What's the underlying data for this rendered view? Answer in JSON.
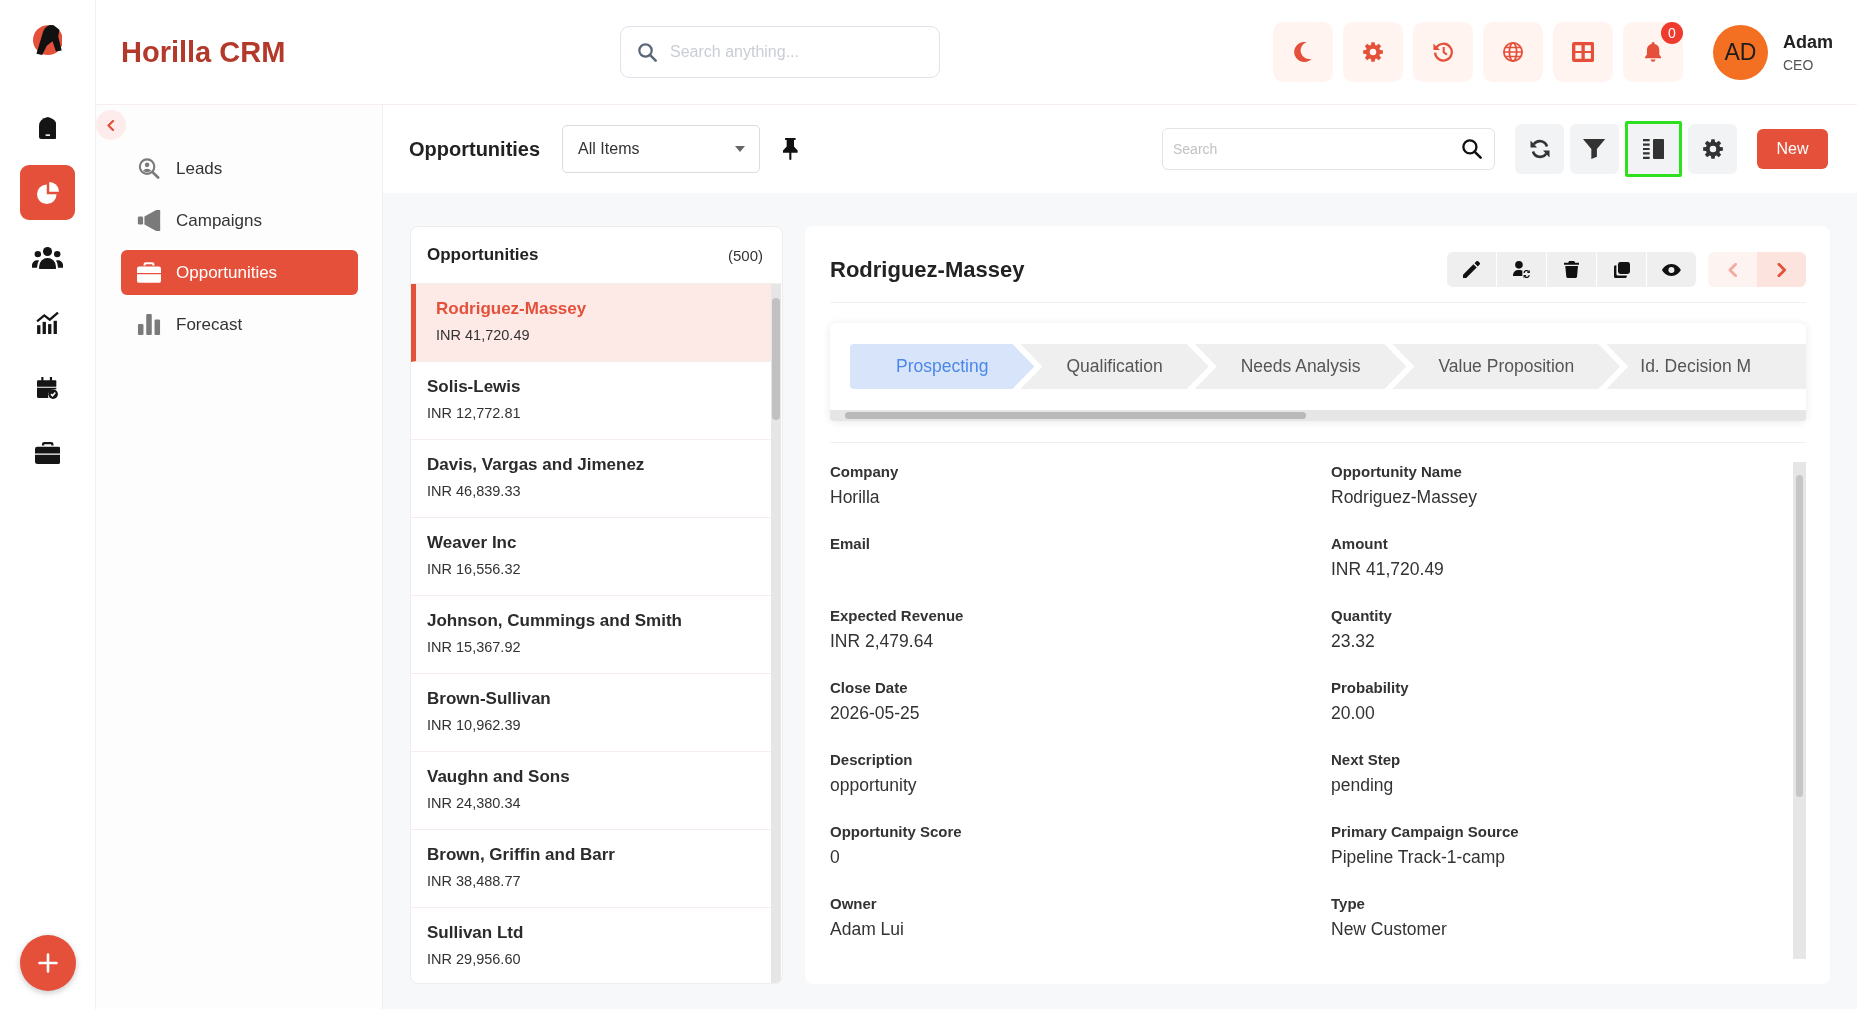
{
  "rail": [
    {
      "selected": false
    },
    {
      "selected": true
    },
    {
      "selected": false
    },
    {
      "selected": false
    },
    {
      "selected": false
    },
    {
      "selected": false
    }
  ],
  "header": {
    "title": "Horilla CRM",
    "search": {
      "placeholder": "Search anything..."
    },
    "notification_count": "0",
    "user": {
      "initials": "AD",
      "name": "Adam",
      "role": "CEO"
    }
  },
  "sidebar": {
    "items": [
      {
        "label": "Leads",
        "selected": false
      },
      {
        "label": "Campaigns",
        "selected": false
      },
      {
        "label": "Opportunities",
        "selected": true
      },
      {
        "label": "Forecast",
        "selected": false
      }
    ]
  },
  "toolbar": {
    "title": "Opportunities",
    "view_select": "All Items",
    "search": {
      "placeholder": "Search"
    },
    "view_buttons": [
      {
        "selected": false
      },
      {
        "selected": false
      },
      {
        "selected": true
      },
      {
        "selected": false
      }
    ],
    "new_button": "New"
  },
  "list": {
    "title": "Opportunities",
    "count": "(500)",
    "items": [
      {
        "name": "Rodriguez-Massey",
        "amount": "INR 41,720.49",
        "selected": true
      },
      {
        "name": "Solis-Lewis",
        "amount": "INR 12,772.81",
        "selected": false
      },
      {
        "name": "Davis, Vargas and Jimenez",
        "amount": "INR 46,839.33",
        "selected": false
      },
      {
        "name": "Weaver Inc",
        "amount": "INR 16,556.32",
        "selected": false
      },
      {
        "name": "Johnson, Cummings and Smith",
        "amount": "INR 15,367.92",
        "selected": false
      },
      {
        "name": "Brown-Sullivan",
        "amount": "INR 10,962.39",
        "selected": false
      },
      {
        "name": "Vaughn and Sons",
        "amount": "INR 24,380.34",
        "selected": false
      },
      {
        "name": "Brown, Griffin and Barr",
        "amount": "INR 38,488.77",
        "selected": false
      },
      {
        "name": "Sullivan Ltd",
        "amount": "INR 29,956.60",
        "selected": false
      }
    ]
  },
  "detail": {
    "title": "Rodriguez-Massey",
    "pager": [
      {
        "disabled": true
      },
      {
        "disabled": false
      }
    ],
    "stages": [
      {
        "label": "Prospecting",
        "selected": true
      },
      {
        "label": "Qualification",
        "selected": false
      },
      {
        "label": "Needs Analysis",
        "selected": false
      },
      {
        "label": "Value Proposition",
        "selected": false
      },
      {
        "label": "Id. Decision M",
        "selected": false
      }
    ],
    "fields": [
      {
        "label": "Company",
        "value": "Horilla"
      },
      {
        "label": "Opportunity Name",
        "value": "Rodriguez-Massey"
      },
      {
        "label": "Email"
      },
      {
        "label": "Amount",
        "value": "INR 41,720.49"
      },
      {
        "label": "Expected Revenue",
        "value": "INR 2,479.64"
      },
      {
        "label": "Quantity",
        "value": "23.32"
      },
      {
        "label": "Close Date",
        "value": "2026-05-25"
      },
      {
        "label": "Probability",
        "value": "20.00"
      },
      {
        "label": "Description",
        "value": "opportunity"
      },
      {
        "label": "Next Step",
        "value": "pending"
      },
      {
        "label": "Opportunity Score",
        "value": "0"
      },
      {
        "label": "Primary Campaign Source",
        "value": "Pipeline Track-1-camp"
      },
      {
        "label": "Owner",
        "value": "Adam Lui"
      },
      {
        "label": "Type",
        "value": "New Customer"
      }
    ]
  }
}
